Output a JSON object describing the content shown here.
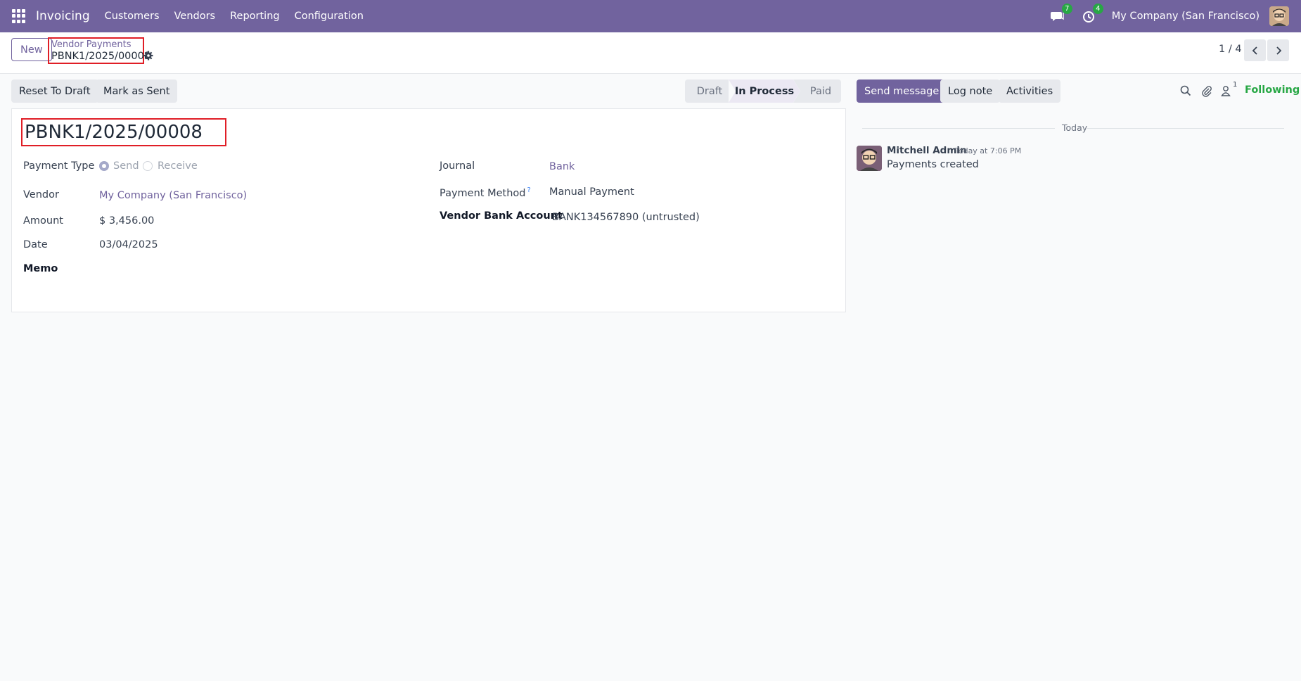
{
  "navbar": {
    "brand": "Invoicing",
    "menu": [
      "Customers",
      "Vendors",
      "Reporting",
      "Configuration"
    ],
    "messages_count": "7",
    "activities_count": "4",
    "company": "My Company (San Francisco)"
  },
  "control": {
    "new_label": "New",
    "breadcrumb_parent": "Vendor Payments",
    "breadcrumb_current": "PBNK1/2025/00008",
    "pager": "1 / 4"
  },
  "actions": {
    "reset_to_draft": "Reset To Draft",
    "mark_as_sent": "Mark as Sent"
  },
  "status": {
    "stages": [
      "Draft",
      "In Process",
      "Paid"
    ],
    "current": "In Process"
  },
  "form": {
    "title": "PBNK1/2025/00008",
    "payment_type_label": "Payment Type",
    "payment_type_options": [
      "Send",
      "Receive"
    ],
    "payment_type_selected": "Send",
    "vendor_label": "Vendor",
    "vendor_value": "My Company (San Francisco)",
    "amount_label": "Amount",
    "amount_value": "$ 3,456.00",
    "date_label": "Date",
    "date_value": "03/04/2025",
    "memo_label": "Memo",
    "journal_label": "Journal",
    "journal_value": "Bank",
    "payment_method_label": "Payment Method",
    "payment_method_help": "?",
    "payment_method_value": "Manual Payment",
    "vendor_bank_label": "Vendor Bank Account",
    "vendor_bank_value": "BANK134567890 (untrusted)"
  },
  "chatter": {
    "send_message": "Send message",
    "log_note": "Log note",
    "activities": "Activities",
    "followers_count": "1",
    "following": "Following",
    "date_divider": "Today",
    "messages": [
      {
        "author": "Mitchell Admin",
        "time": "Today at 7:06 PM",
        "body": "Payments created"
      }
    ]
  },
  "colors": {
    "brand": "#71639e",
    "success": "#28a745",
    "highlight": "#e01e26"
  }
}
